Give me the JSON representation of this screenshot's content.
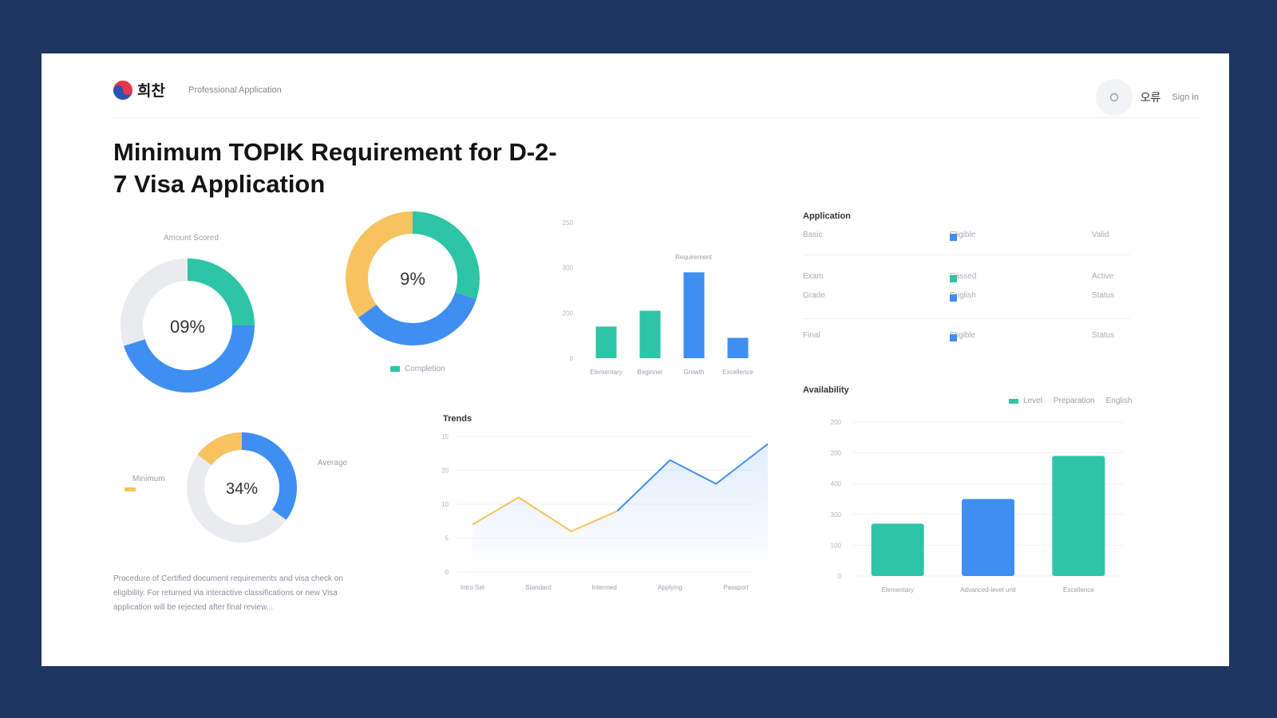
{
  "header": {
    "logo_text": "희찬",
    "nav_text": "Professional Application",
    "lang": "오류",
    "user": "Sign in"
  },
  "title": "Minimum TOPIK Requirement for D-2-7 Visa Application",
  "donut1": {
    "label": "Amount Scored",
    "center": "09%"
  },
  "donut2": {
    "center": "9%",
    "legend": "Completion"
  },
  "donut3": {
    "center": "34%",
    "left_label": "Minimum",
    "right_label": "Average"
  },
  "paragraph": "Procedure of Certified document requirements and visa check on eligibility. For returned via interactive classifications or new Visa application will be rejected after final review...",
  "colors": {
    "teal": "#2ec4a6",
    "blue": "#3f8ef2",
    "yellow": "#f7c35f",
    "gray": "#e9ebee"
  },
  "apps_table": {
    "title": "Application",
    "rows": [
      {
        "name": "Basic",
        "status": "Eligible",
        "color": "#3f8ef2",
        "value": "Valid"
      },
      {
        "name": "Exam",
        "status": "Passed",
        "color": "#2ec4a6",
        "value": "Active"
      },
      {
        "name": "Grade",
        "status": "English",
        "color": "#3f8ef2",
        "value": "Status"
      },
      {
        "name": "Final",
        "status": "Eligible",
        "color": "#3f8ef2",
        "value": "Status"
      }
    ]
  },
  "chart_data": [
    {
      "type": "pie",
      "title": "Amount Scored",
      "center_label": "09%",
      "slices": [
        {
          "color": "#2ec4a6",
          "value": 25
        },
        {
          "color": "#3f8ef2",
          "value": 45
        },
        {
          "color": "#e9ebee",
          "value": 30
        }
      ]
    },
    {
      "type": "pie",
      "center_label": "9%",
      "legend": [
        "Completion"
      ],
      "slices": [
        {
          "color": "#2ec4a6",
          "value": 30
        },
        {
          "color": "#3f8ef2",
          "value": 35
        },
        {
          "color": "#f7c35f",
          "value": 35
        }
      ]
    },
    {
      "type": "pie",
      "center_label": "34%",
      "slices": [
        {
          "color": "#3f8ef2",
          "value": 35
        },
        {
          "color": "#e9ebee",
          "value": 50
        },
        {
          "color": "#f7c35f",
          "value": 15
        }
      ]
    },
    {
      "type": "bar",
      "annotation": "Requirement",
      "categories": [
        "Elementary",
        "Beginner",
        "Growth",
        "Excellence"
      ],
      "values": [
        70,
        105,
        190,
        45
      ],
      "colors": [
        "#2ec4a6",
        "#2ec4a6",
        "#3f8ef2",
        "#3f8ef2"
      ],
      "yticks": [
        "0",
        "200",
        "300",
        "250"
      ],
      "ylim": [
        0,
        300
      ]
    },
    {
      "type": "line",
      "title": "Trends",
      "x": [
        "Intro Set",
        "Standard",
        "Intermed",
        "Applying",
        "Passport"
      ],
      "series": [
        {
          "color": "#f7c35f",
          "points": [
            [
              0,
              7
            ],
            [
              0.7,
              11
            ],
            [
              1.5,
              6
            ],
            [
              2.2,
              9
            ]
          ]
        },
        {
          "color": "#3f8ef2",
          "points": [
            [
              2.2,
              9
            ],
            [
              3.0,
              16.5
            ],
            [
              3.7,
              13
            ],
            [
              4.5,
              19
            ]
          ]
        }
      ],
      "yticks": [
        "0",
        "5",
        "10",
        "20",
        "15"
      ],
      "ylim": [
        0,
        20
      ]
    },
    {
      "type": "bar",
      "title": "Availability",
      "legend": [
        "Level",
        "Preparation",
        "English"
      ],
      "legend_colors": [
        "#2ec4a6",
        "#3f8ef2",
        "#cccccc"
      ],
      "categories": [
        "Elementary",
        "Advanced-level unit",
        "Excellence"
      ],
      "values": [
        170,
        250,
        390
      ],
      "colors": [
        "#2ec4a6",
        "#3f8ef2",
        "#2ec4a6"
      ],
      "yticks": [
        "0",
        "100",
        "300",
        "400",
        "200",
        "200"
      ],
      "ylim": [
        0,
        500
      ]
    }
  ]
}
